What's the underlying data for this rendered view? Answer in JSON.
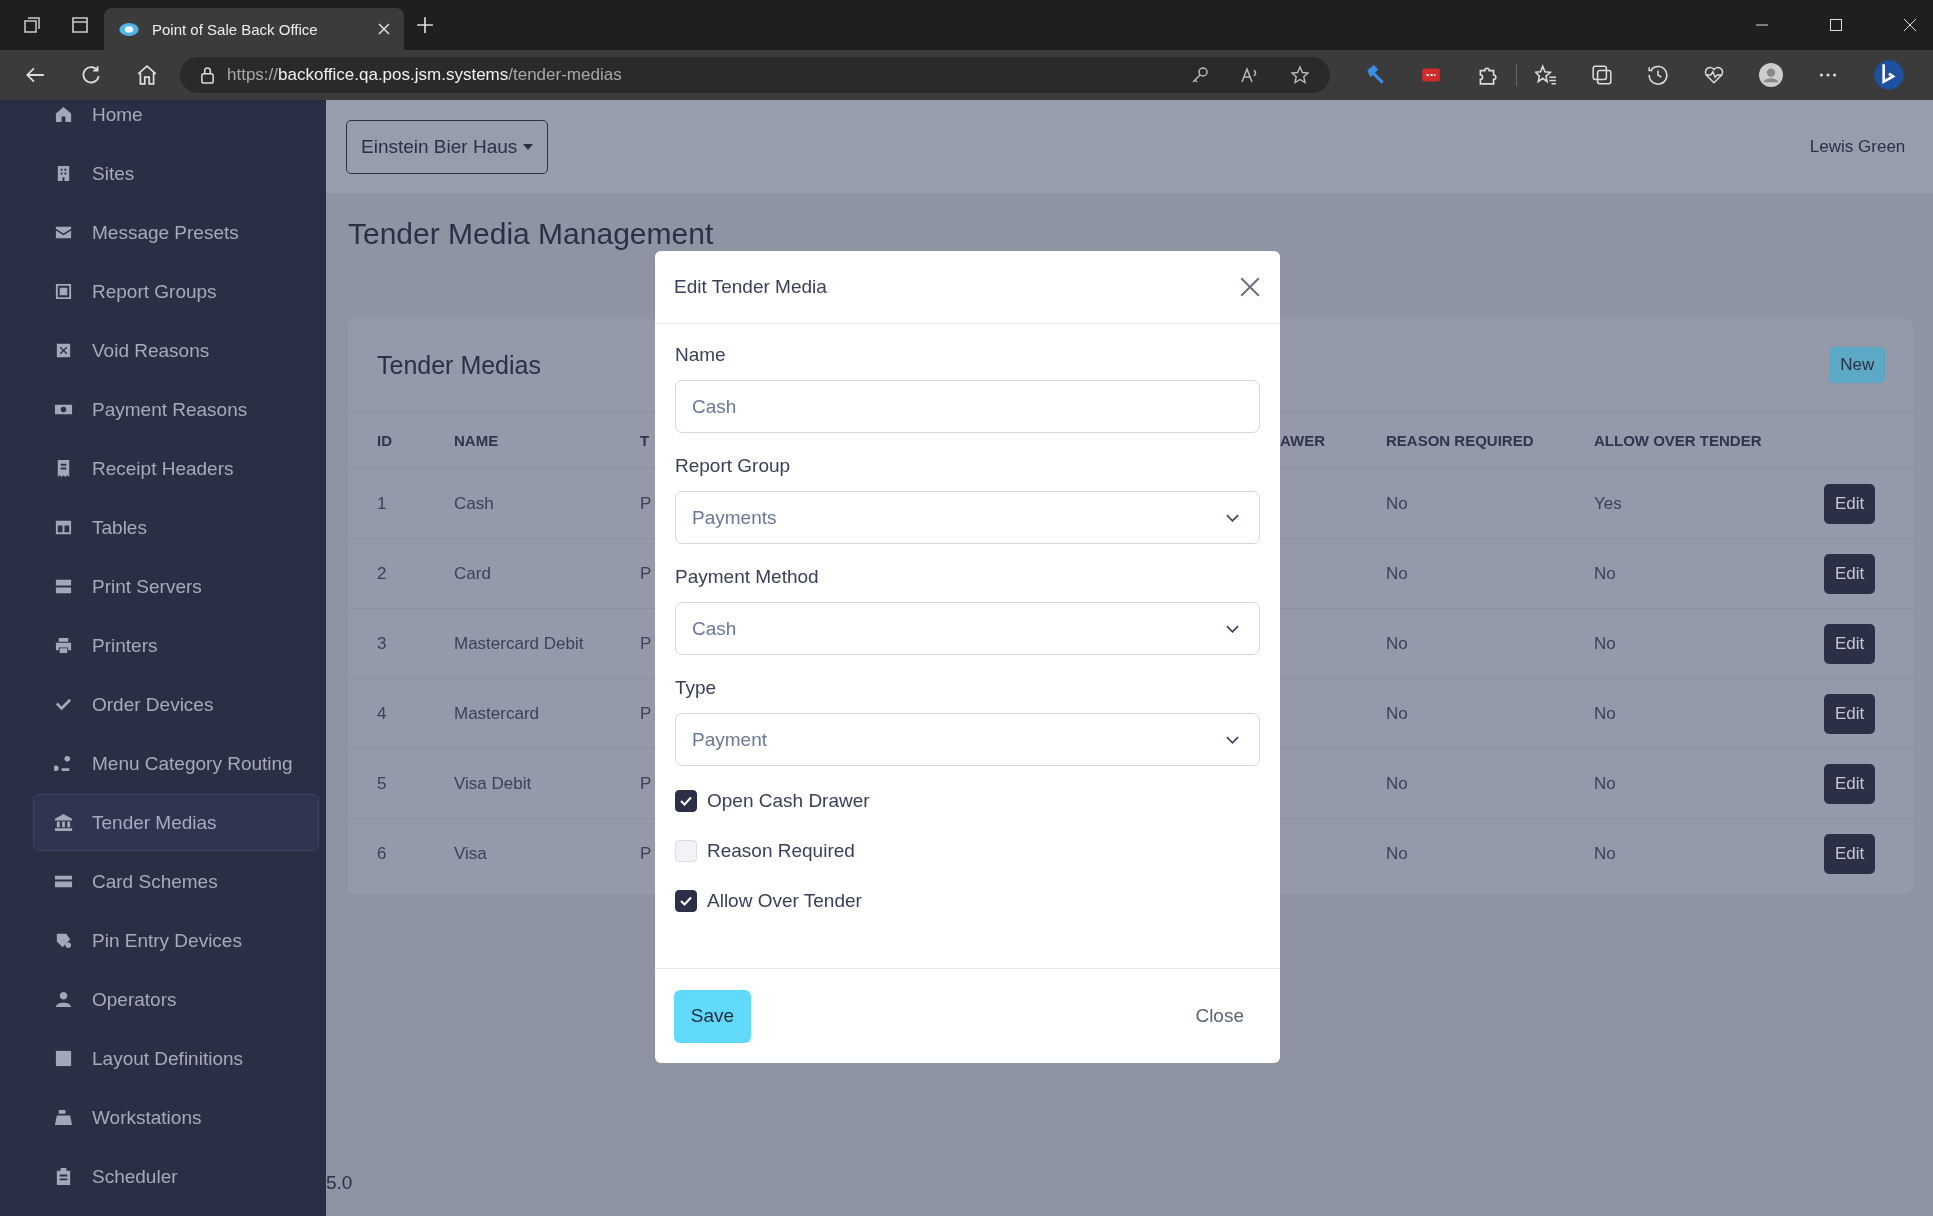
{
  "browser": {
    "tab_title": "Point of Sale Back Office",
    "url": {
      "scheme": "https://",
      "host": "backoffice.qa.pos.jsm.systems",
      "path": "/tender-medias"
    }
  },
  "sidebar": {
    "items": [
      {
        "label": "Home",
        "selected": false
      },
      {
        "label": "Sites",
        "selected": false
      },
      {
        "label": "Message Presets",
        "selected": false
      },
      {
        "label": "Report Groups",
        "selected": false
      },
      {
        "label": "Void Reasons",
        "selected": false
      },
      {
        "label": "Payment Reasons",
        "selected": false
      },
      {
        "label": "Receipt Headers",
        "selected": false
      },
      {
        "label": "Tables",
        "selected": false
      },
      {
        "label": "Print Servers",
        "selected": false
      },
      {
        "label": "Printers",
        "selected": false
      },
      {
        "label": "Order Devices",
        "selected": false
      },
      {
        "label": "Menu Category Routing",
        "selected": false
      },
      {
        "label": "Tender Medias",
        "selected": true
      },
      {
        "label": "Card Schemes",
        "selected": false
      },
      {
        "label": "Pin Entry Devices",
        "selected": false
      },
      {
        "label": "Operators",
        "selected": false
      },
      {
        "label": "Layout Definitions",
        "selected": false
      },
      {
        "label": "Workstations",
        "selected": false
      },
      {
        "label": "Scheduler",
        "selected": false
      }
    ]
  },
  "header": {
    "site_selector": "Einstein Bier Haus",
    "user": "Lewis Green"
  },
  "page_title": "Tender Media Management",
  "card": {
    "title": "Tender Medias",
    "new_button": "New",
    "table": {
      "columns": [
        "ID",
        "NAME",
        "T",
        "AWER",
        "REASON REQUIRED",
        "ALLOW OVER TENDER"
      ],
      "rows": [
        {
          "id": "1",
          "name": "Cash",
          "column_3": "P",
          "reason_required": "No",
          "allow_over_tender": "Yes",
          "action": "Edit"
        },
        {
          "id": "2",
          "name": "Card",
          "column_3": "P",
          "reason_required": "No",
          "allow_over_tender": "No",
          "action": "Edit"
        },
        {
          "id": "3",
          "name": "Mastercard Debit",
          "column_3": "P",
          "reason_required": "No",
          "allow_over_tender": "No",
          "action": "Edit"
        },
        {
          "id": "4",
          "name": "Mastercard",
          "column_3": "P",
          "reason_required": "No",
          "allow_over_tender": "No",
          "action": "Edit"
        },
        {
          "id": "5",
          "name": "Visa Debit",
          "column_3": "P",
          "reason_required": "No",
          "allow_over_tender": "No",
          "action": "Edit"
        },
        {
          "id": "6",
          "name": "Visa",
          "column_3": "P",
          "reason_required": "No",
          "allow_over_tender": "No",
          "action": "Edit"
        }
      ]
    }
  },
  "version": "5.0",
  "modal": {
    "title": "Edit Tender Media",
    "fields": [
      {
        "label": "Name",
        "kind": "text",
        "placeholder": "Cash"
      },
      {
        "label": "Report Group",
        "kind": "select",
        "value": "Payments"
      },
      {
        "label": "Payment Method",
        "kind": "select",
        "value": "Cash"
      },
      {
        "label": "Type",
        "kind": "select",
        "value": "Payment"
      }
    ],
    "checkboxes": [
      {
        "label": "Open Cash Drawer",
        "checked": true
      },
      {
        "label": "Reason Required",
        "checked": false
      },
      {
        "label": "Allow Over Tender",
        "checked": true
      }
    ],
    "save_button": "Save",
    "close_button": "Close"
  }
}
